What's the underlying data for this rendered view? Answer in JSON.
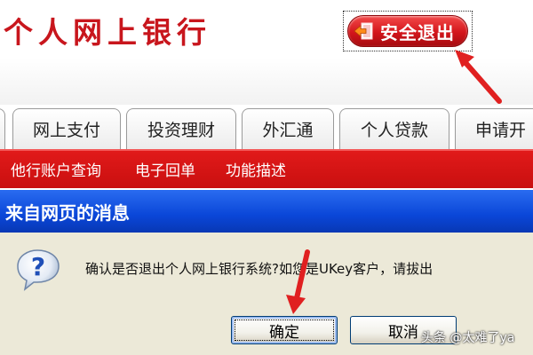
{
  "header": {
    "bank_title": "个人网上银行",
    "logout_label": "安全退出"
  },
  "tabs": [
    {
      "label": ""
    },
    {
      "label": "网上支付"
    },
    {
      "label": "投资理财"
    },
    {
      "label": "外汇通"
    },
    {
      "label": "个人贷款"
    },
    {
      "label": "申请开"
    }
  ],
  "subnav": {
    "items": [
      {
        "label": "他行账户查询"
      },
      {
        "label": "电子回单"
      },
      {
        "label": "功能描述"
      }
    ]
  },
  "dialog": {
    "title": "来自网页的消息",
    "message": "确认是否退出个人网上银行系统?如您是UKey客户，请拔出",
    "ok_label": "确定",
    "cancel_label": "取消"
  },
  "watermark": "头条 @太难了ya",
  "colors": {
    "brand_red": "#c8161d",
    "dialog_blue": "#0a46d8",
    "dialog_body": "#ece9d8"
  }
}
